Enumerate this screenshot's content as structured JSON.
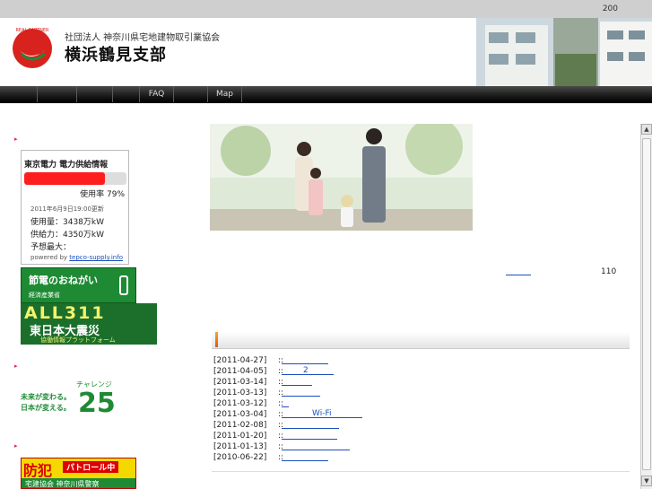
{
  "topbar": {
    "counter": "200"
  },
  "header": {
    "logo_text": "REAL PARTNER",
    "org_sub": "社団法人 神奈川県宅地建物取引業協会",
    "org_main": "横浜鶴見支部"
  },
  "nav": {
    "items": [
      {
        "label": ""
      },
      {
        "label": ""
      },
      {
        "label": ""
      },
      {
        "label": "FAQ"
      },
      {
        "label": ""
      },
      {
        "label": "Map"
      }
    ]
  },
  "power": {
    "title": "東京電力 電力供給情報",
    "bar_fill_pct": 79,
    "bar_color": "#ff1e1e",
    "usage": "使用率 79%",
    "date": "2011年6月9日19:00更新",
    "row1": "使用量：3438万kW",
    "row2": "供給力：4350万kW",
    "row3": "予想最大：",
    "powered_by": "powered by",
    "powered_link": "tepco-supply.info"
  },
  "banners": {
    "setsuden_title": "節電のおねがい",
    "setsuden_sub": "経済産業省",
    "all311_title": "ALL311",
    "all311_sub": "東日本大震災",
    "all311_note": "協働情報プラットフォーム",
    "challenge_line1": "未来が変わる。",
    "challenge_line2": "日本が変える。",
    "challenge_label": "チャレンジ",
    "challenge_num": "25",
    "bouhan_title": "防犯",
    "bouhan_patrol": "パトロール中",
    "bouhan_sub": "宅建協会 神奈川県警察"
  },
  "main": {
    "number": "110"
  },
  "news": [
    {
      "date": "[2011-04-27]",
      "sep": "::",
      "text": ""
    },
    {
      "date": "[2011-04-05]",
      "sep": "::",
      "text": "2"
    },
    {
      "date": "[2011-03-14]",
      "sep": "::",
      "text": ""
    },
    {
      "date": "[2011-03-13]",
      "sep": "::",
      "text": ""
    },
    {
      "date": "[2011-03-12]",
      "sep": "::",
      "text": ""
    },
    {
      "date": "[2011-03-04]",
      "sep": "::",
      "text": "Wi-Fi"
    },
    {
      "date": "[2011-02-08]",
      "sep": "::",
      "text": ""
    },
    {
      "date": "[2011-01-20]",
      "sep": "::",
      "text": ""
    },
    {
      "date": "[2011-01-13]",
      "sep": "::",
      "text": ""
    },
    {
      "date": "[2010-06-22]",
      "sep": "::",
      "text": ""
    }
  ],
  "colors": {
    "accent": "#1e8a34",
    "nav_bg": "#1e1e1e",
    "link": "#1a4fbf"
  }
}
